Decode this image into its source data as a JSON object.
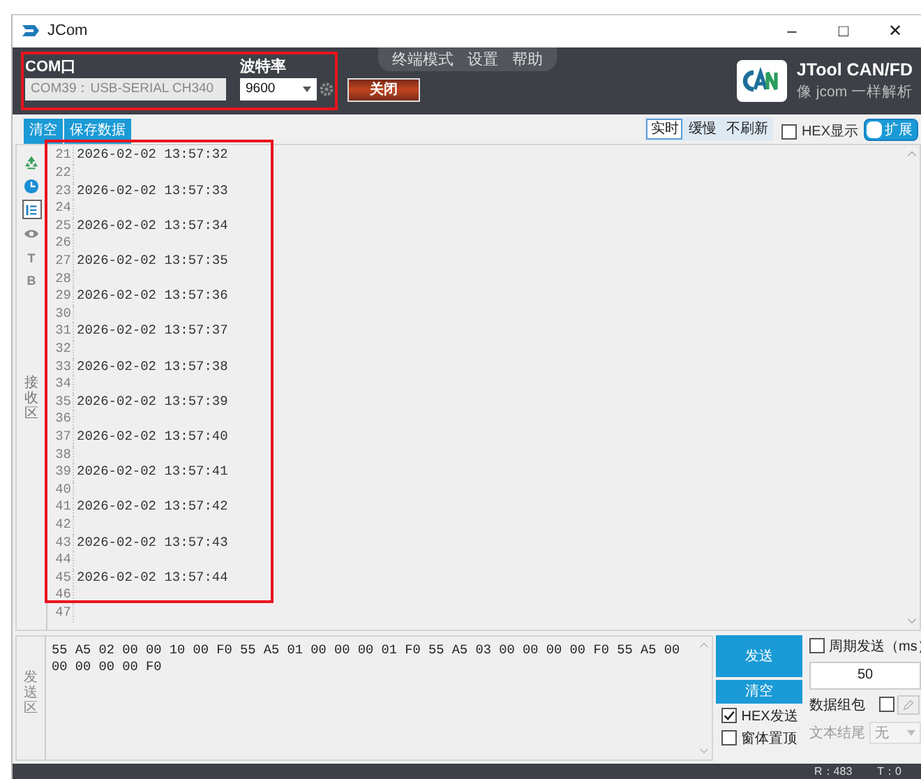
{
  "window": {
    "title": "JCom",
    "controls": [
      "–",
      "□",
      "✕"
    ]
  },
  "header": {
    "port_label": "COM口",
    "port_value": "COM39：USB-SERIAL CH340",
    "baud_label": "波特率",
    "baud_value": "9600",
    "close_button": "关闭",
    "menu": [
      "终端模式",
      "设置",
      "帮助"
    ],
    "logo_text": "JTool CAN/FD",
    "logo_subtext": "像 jcom 一样解析"
  },
  "toolbar": {
    "buttons": [
      "清空",
      "保存数据"
    ],
    "refresh_modes": [
      {
        "label": "实时",
        "selected": true
      },
      {
        "label": "缓慢",
        "selected": false
      },
      {
        "label": "不刷新",
        "selected": false
      }
    ],
    "hex_display": {
      "label": "HEX显示",
      "checked": false
    },
    "extend": {
      "label": "扩展",
      "on": false
    }
  },
  "receive": {
    "side_label": "接收区",
    "tools": [
      {
        "kind": "icon",
        "selected": false
      },
      {
        "kind": "icon",
        "selected": false
      },
      {
        "kind": "icon",
        "selected": true
      },
      {
        "kind": "icon",
        "selected": false
      },
      {
        "kind": "letter",
        "label": "T"
      },
      {
        "kind": "letter",
        "label": "B"
      }
    ],
    "lines": [
      {
        "number": "21",
        "text": "2026-02-02 13:57:32"
      },
      {
        "number": "22"
      },
      {
        "number": "23",
        "text": "2026-02-02 13:57:33"
      },
      {
        "number": "24"
      },
      {
        "number": "25",
        "text": "2026-02-02 13:57:34"
      },
      {
        "number": "26"
      },
      {
        "number": "27",
        "text": "2026-02-02 13:57:35"
      },
      {
        "number": "28"
      },
      {
        "number": "29",
        "text": "2026-02-02 13:57:36"
      },
      {
        "number": "30"
      },
      {
        "number": "31",
        "text": "2026-02-02 13:57:37"
      },
      {
        "number": "32"
      },
      {
        "number": "33",
        "text": "2026-02-02 13:57:38"
      },
      {
        "number": "34"
      },
      {
        "number": "35",
        "text": "2026-02-02 13:57:39"
      },
      {
        "number": "36"
      },
      {
        "number": "37",
        "text": "2026-02-02 13:57:40"
      },
      {
        "number": "38"
      },
      {
        "number": "39",
        "text": "2026-02-02 13:57:41"
      },
      {
        "number": "40"
      },
      {
        "number": "41",
        "text": "2026-02-02 13:57:42"
      },
      {
        "number": "42"
      },
      {
        "number": "43",
        "text": "2026-02-02 13:57:43"
      },
      {
        "number": "44"
      },
      {
        "number": "45",
        "text": "2026-02-02 13:57:44"
      },
      {
        "number": "46"
      },
      {
        "number": "47"
      }
    ]
  },
  "send": {
    "side_label": "发送区",
    "text": "55 A5 02 00 00 10 00 F0 55 A5 01 00 00 00 01 F0 55 A5 03 00 00 00 00 F0 55 A5 00 00 00 00 00 F0",
    "send_button": "发送",
    "clear_button": "清空",
    "options": [
      {
        "label": "HEX发送",
        "checked": true
      },
      {
        "label": "窗体置顶",
        "checked": false
      }
    ],
    "periodic": {
      "label": "周期发送（ms）",
      "checked": false,
      "interval": "50"
    },
    "packet": {
      "label": "数据组包",
      "checked": false
    },
    "ending": {
      "label": "文本结尾",
      "value": "无"
    }
  },
  "status_bar": {
    "received": "R：483",
    "sent": "T：0"
  }
}
